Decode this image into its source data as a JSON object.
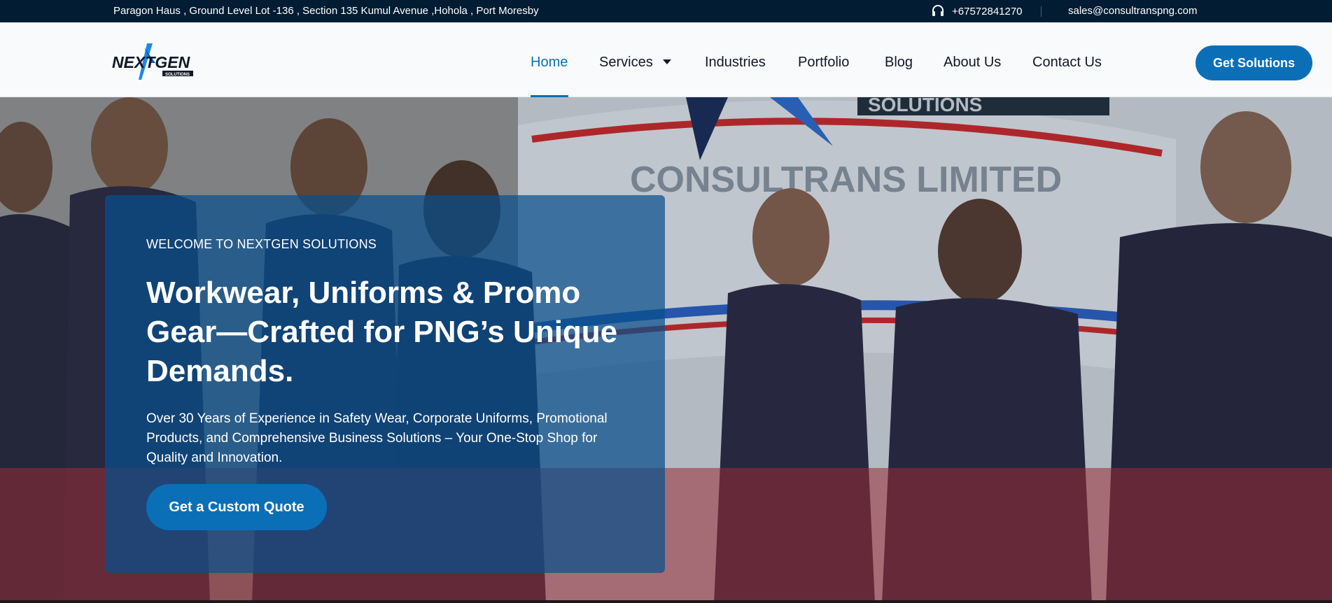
{
  "topbar": {
    "address": "Paragon Haus , Ground Level Lot -136 , Section 135 Kumul Avenue ,Hohola , Port Moresby",
    "phone": "+67572841270",
    "phone_icon": "headset-icon",
    "email": "sales@consultranspng.com"
  },
  "header": {
    "logo_text": "NEXTGEN",
    "logo_subtext": "SOLUTIONS",
    "nav": [
      {
        "label": "Home",
        "active": true
      },
      {
        "label": "Services",
        "has_dropdown": true
      },
      {
        "label": "Industries"
      },
      {
        "label": "Portfolio"
      },
      {
        "label": "Blog"
      },
      {
        "label": "About Us"
      },
      {
        "label": "Contact Us"
      }
    ],
    "cta_label": "Get Solutions"
  },
  "hero": {
    "background_sign_line1": "SOLUTIONS",
    "background_sign_line2": "CONSULTRANS LIMITED",
    "eyebrow": "WELCOME TO NEXTGEN SOLUTIONS",
    "headline": "Workwear, Uniforms & Promo Gear—Crafted for PNG’s Unique Demands.",
    "subtext": "Over 30 Years of Experience in Safety Wear, Corporate Uniforms, Promotional Products, and Comprehensive Business Solutions – Your One-Stop Shop for Quality and Innovation.",
    "button_label": "Get a Custom Quote"
  },
  "colors": {
    "topbar_bg": "#021d33",
    "accent": "#0b6fb8",
    "header_bg": "#f9fafb"
  }
}
